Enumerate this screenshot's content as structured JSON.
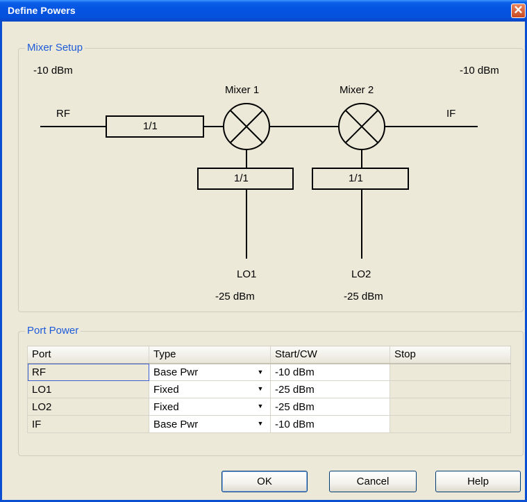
{
  "window": {
    "title": "Define Powers",
    "close_glyph": "✕"
  },
  "mixer_setup": {
    "legend": "Mixer Setup",
    "rf_power": "-10 dBm",
    "if_power": "-10 dBm",
    "rf_label": "RF",
    "if_label": "IF",
    "rf_filter": "1/1",
    "mixer1": {
      "label": "Mixer 1",
      "lo_filter": "1/1",
      "lo_label": "LO1",
      "lo_power": "-25 dBm"
    },
    "mixer2": {
      "label": "Mixer 2",
      "lo_filter": "1/1",
      "lo_label": "LO2",
      "lo_power": "-25 dBm"
    }
  },
  "port_power": {
    "legend": "Port Power",
    "columns": [
      "Port",
      "Type",
      "Start/CW",
      "Stop"
    ],
    "rows": [
      {
        "port": "RF",
        "type": "Base Pwr",
        "start": "-10 dBm",
        "stop": ""
      },
      {
        "port": "LO1",
        "type": "Fixed",
        "start": "-25 dBm",
        "stop": ""
      },
      {
        "port": "LO2",
        "type": "Fixed",
        "start": "-25 dBm",
        "stop": ""
      },
      {
        "port": "IF",
        "type": "Base Pwr",
        "start": "-10 dBm",
        "stop": ""
      }
    ],
    "dropdown_glyph": "▼"
  },
  "buttons": {
    "ok": "OK",
    "cancel": "Cancel",
    "help": "Help"
  },
  "colors": {
    "titlebar": "#0454e2",
    "legend_text": "#1c5ad8",
    "face": "#ece9d8"
  }
}
